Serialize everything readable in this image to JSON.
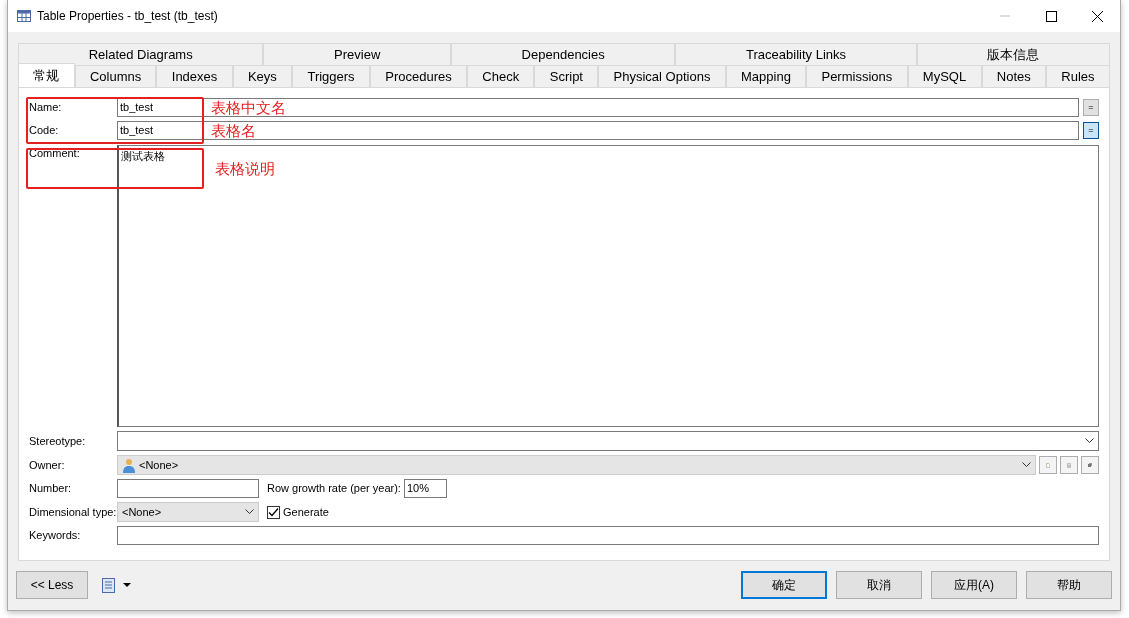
{
  "window": {
    "title": "Table Properties - tb_test (tb_test)"
  },
  "tabs_row_1": [
    {
      "label": "Related Diagrams",
      "selected": false
    },
    {
      "label": "Preview",
      "selected": false
    },
    {
      "label": "Dependencies",
      "selected": false
    },
    {
      "label": "Traceability Links",
      "selected": false
    },
    {
      "label": "版本信息",
      "selected": false
    }
  ],
  "tabs_row_2": [
    {
      "label": "常规",
      "selected": true
    },
    {
      "label": "Columns",
      "selected": false
    },
    {
      "label": "Indexes",
      "selected": false
    },
    {
      "label": "Keys",
      "selected": false
    },
    {
      "label": "Triggers",
      "selected": false
    },
    {
      "label": "Procedures",
      "selected": false
    },
    {
      "label": "Check",
      "selected": false
    },
    {
      "label": "Script",
      "selected": false
    },
    {
      "label": "Physical Options",
      "selected": false
    },
    {
      "label": "Mapping",
      "selected": false
    },
    {
      "label": "Permissions",
      "selected": false
    },
    {
      "label": "MySQL",
      "selected": false
    },
    {
      "label": "Notes",
      "selected": false
    },
    {
      "label": "Rules",
      "selected": false
    }
  ],
  "name": {
    "label": "Name:",
    "value": "tb_test",
    "equal_button": {
      "label": "=",
      "on": false
    }
  },
  "code": {
    "label": "Code:",
    "value": "tb_test",
    "equal_button": {
      "label": "=",
      "on": true
    }
  },
  "comment": {
    "label": "Comment:",
    "value": "测试表格"
  },
  "stereotype": {
    "label": "Stereotype:"
  },
  "owner": {
    "label": "Owner:",
    "value": "<None>"
  },
  "number": {
    "label": "Number:"
  },
  "row_growth_rate": {
    "label": "Row growth rate (per year):",
    "value": "10%"
  },
  "dimensional_type": {
    "label": "Dimensional type:",
    "value": "<None>"
  },
  "generate": {
    "label": "Generate",
    "checked": true
  },
  "keywords": {
    "label": "Keywords:"
  },
  "annotations": [
    {
      "text": "表格中文名"
    },
    {
      "text": "表格名"
    },
    {
      "text": "表格说明"
    }
  ],
  "less_button": "<< Less",
  "dialog_buttons": [
    {
      "label": "确定",
      "default": true
    },
    {
      "label": "取消",
      "default": false
    },
    {
      "label": "应用(A)",
      "default": false
    },
    {
      "label": "帮助",
      "default": false
    }
  ]
}
